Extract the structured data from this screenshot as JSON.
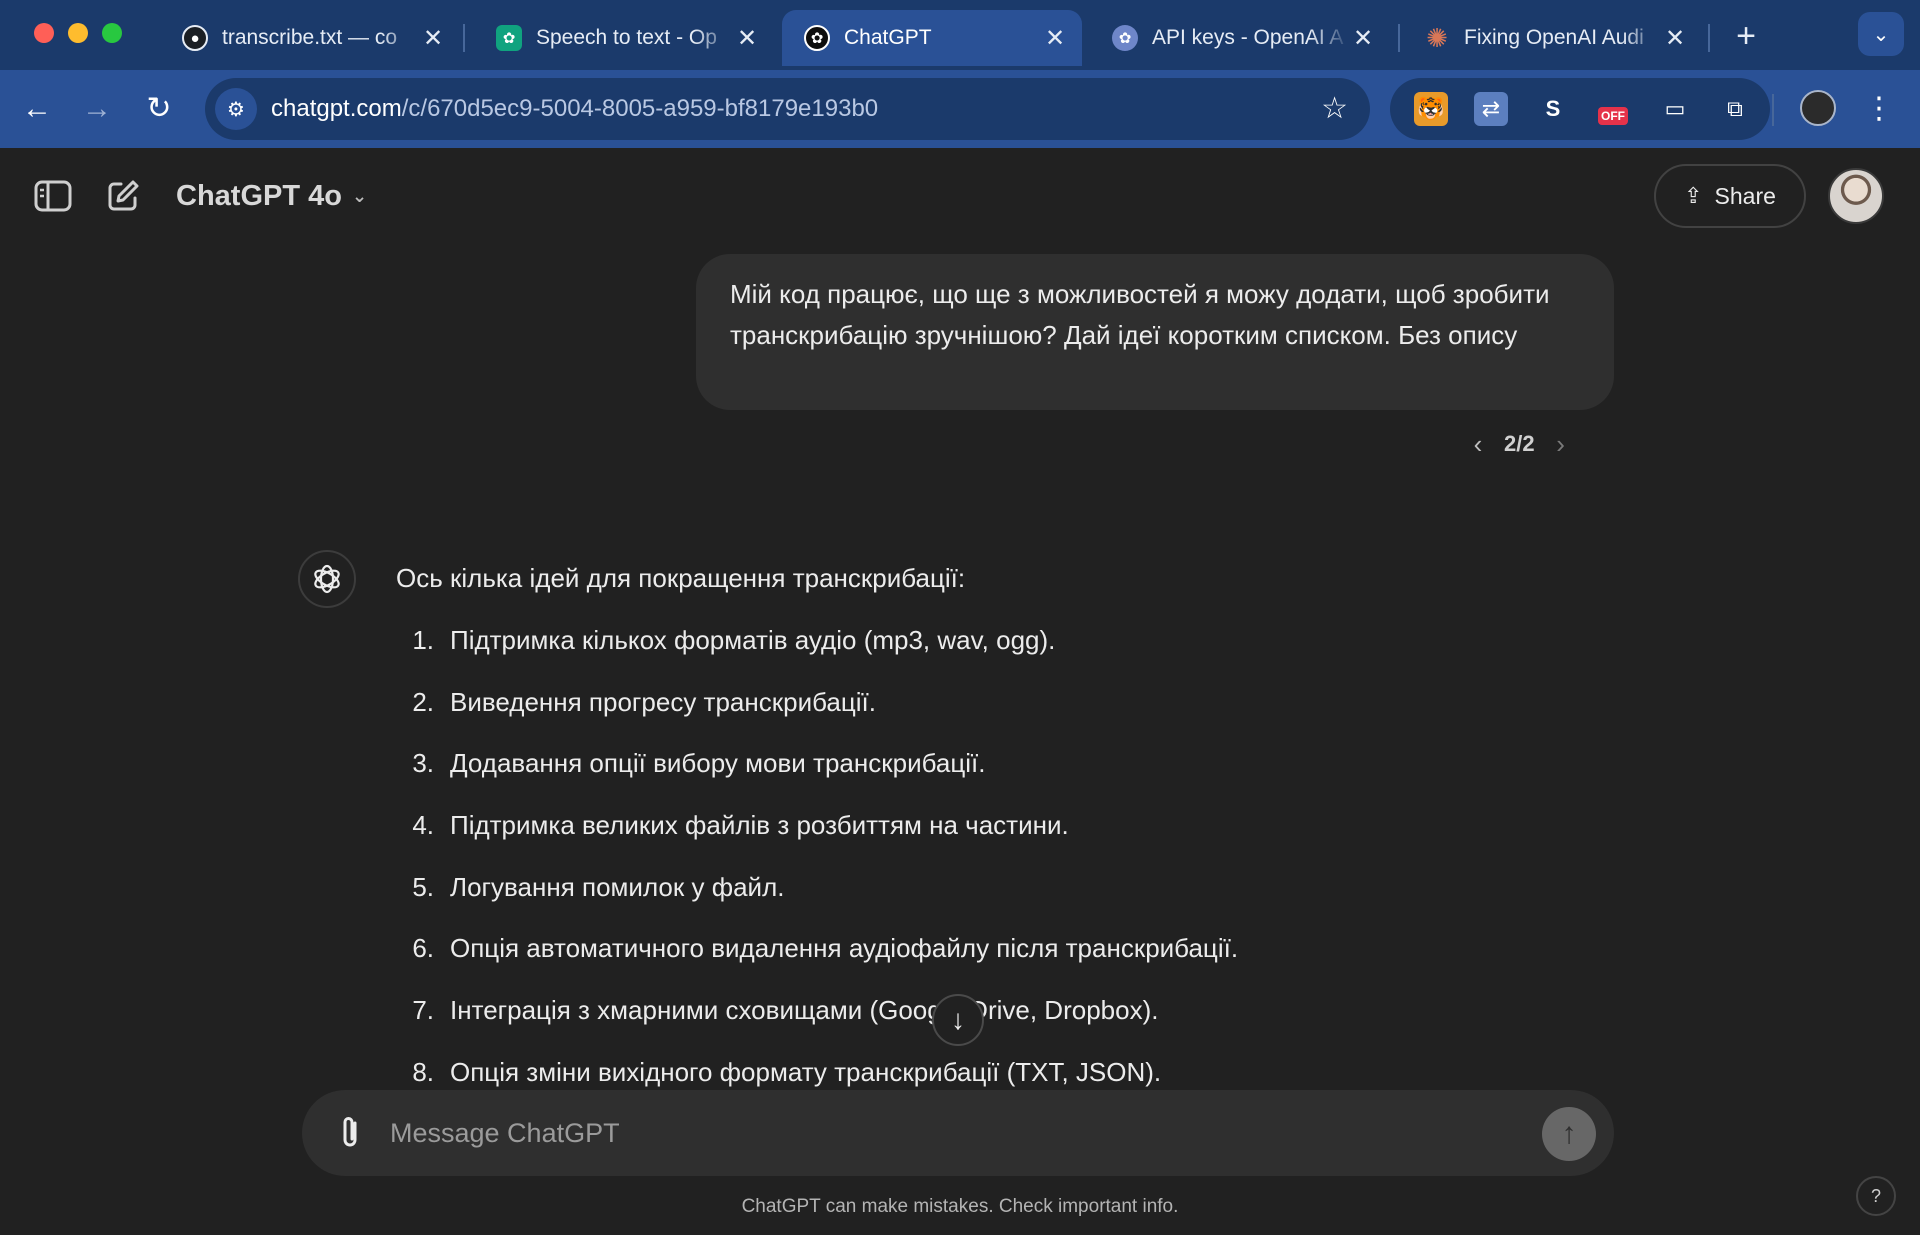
{
  "browser": {
    "tabs": [
      {
        "title": "transcribe.txt — co",
        "favicon": "github-icon",
        "color": "#1b1f24"
      },
      {
        "title": "Speech to text - Op",
        "favicon": "openai-icon",
        "color": "#10a37f"
      },
      {
        "title": "ChatGPT",
        "favicon": "chatgpt-icon",
        "color": "#0d0d0d",
        "active": true
      },
      {
        "title": "API keys - OpenAI A",
        "favicon": "openai-platform-icon",
        "color": "#6e86c9"
      },
      {
        "title": "Fixing OpenAI Audi",
        "favicon": "claude-icon",
        "color": "#d97757"
      }
    ],
    "url_host": "chatgpt.com",
    "url_path": "/c/670d5ec9-5004-8005-a959-bf8179e193b0",
    "extensions": [
      "tiger-extension-icon",
      "translate-extension-icon",
      "s-extension-icon",
      "off-extension-icon",
      "screenshot-extension-icon",
      "extensions-puzzle-icon"
    ],
    "ext_s_label": "S",
    "ext_off_label": "OFF"
  },
  "header": {
    "model": "ChatGPT 4o",
    "share_label": "Share"
  },
  "conversation": {
    "user_message": "Мій код працює, що ще з можливостей я можу додати, щоб зробити транскрибацію зручнішою? Дай ідеї коротким списком. Без опису",
    "pager": "2/2",
    "assistant_intro": "Ось кілька ідей для покращення транскрибації:",
    "ideas": [
      "Підтримка кількох форматів аудіо (mp3, wav, ogg).",
      "Виведення прогресу транскрибації.",
      "Додавання опції вибору мови транскрибації.",
      "Підтримка великих файлів з розбиттям на частини.",
      "Логування помилок у файл.",
      "Опція автоматичного видалення аудіофайлу після транскрибації.",
      "Інтеграція з хмарними сховищами (Google Drive, Dropbox).",
      "Опція зміни вихідного формату транскрибації (TXT, JSON)."
    ]
  },
  "composer": {
    "placeholder": "Message ChatGPT"
  },
  "footer": {
    "disclaimer": "ChatGPT can make mistakes. Check important info.",
    "help": "?"
  },
  "colors": {
    "tabstrip": "#1b3a6b",
    "toolbar": "#2a5196",
    "app_bg": "#212121",
    "bubble": "#2f2f2f"
  }
}
